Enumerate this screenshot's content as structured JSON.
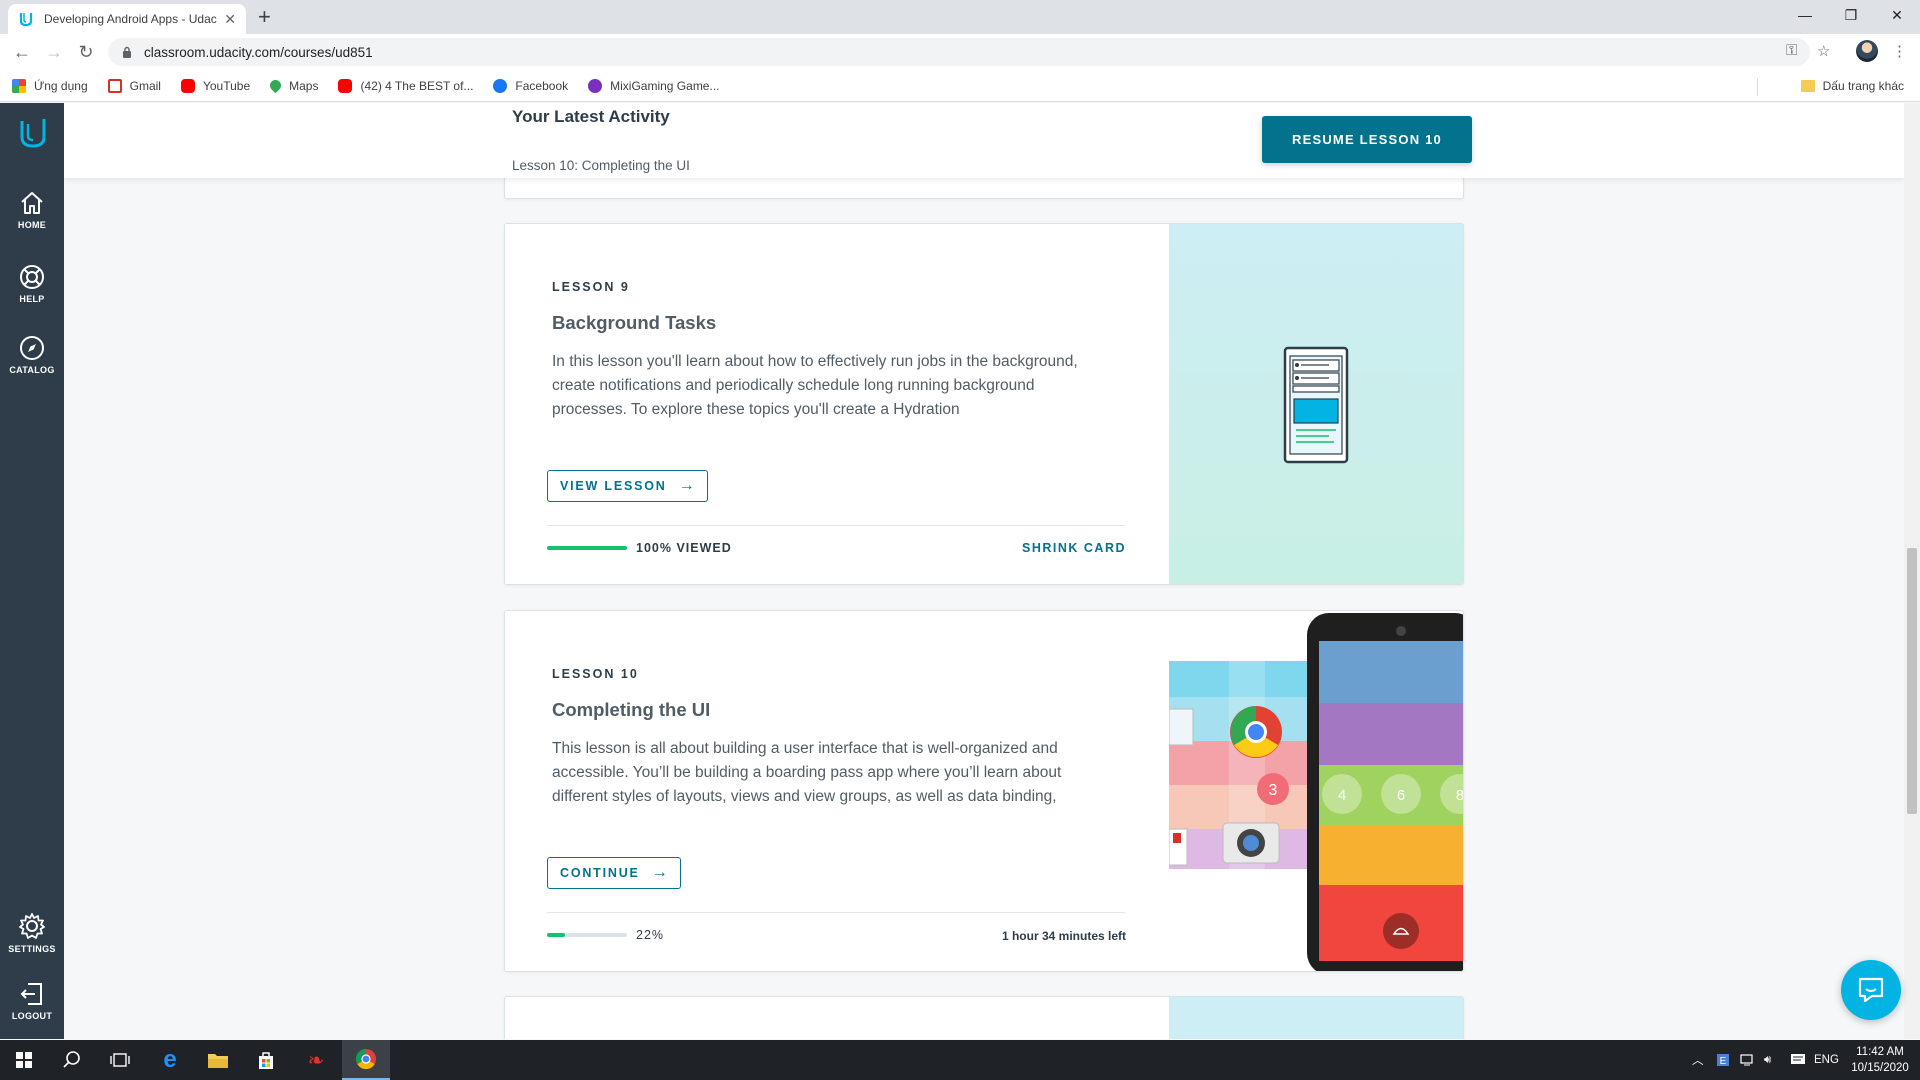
{
  "browser": {
    "tab_title": "Developing Android Apps - Udac",
    "url": "classroom.udacity.com/courses/ud851",
    "bookmarks": [
      {
        "label": "Ứng dụng",
        "color": "#e94235"
      },
      {
        "label": "Gmail",
        "color": "#d93025"
      },
      {
        "label": "YouTube",
        "color": "#ff0000"
      },
      {
        "label": "Maps",
        "color": "#34a853"
      },
      {
        "label": "(42) 4 The BEST of...",
        "color": "#ff0000"
      },
      {
        "label": "Facebook",
        "color": "#1877f2"
      },
      {
        "label": "MixiGaming Game...",
        "color": "#7b2fbe"
      }
    ],
    "other_bookmarks": "Dấu trang khác"
  },
  "sidebar": {
    "items": [
      {
        "label": "HOME",
        "icon": "home-icon"
      },
      {
        "label": "HELP",
        "icon": "lifebuoy-icon"
      },
      {
        "label": "CATALOG",
        "icon": "compass-icon"
      },
      {
        "label": "SETTINGS",
        "icon": "gear-icon"
      },
      {
        "label": "LOGOUT",
        "icon": "logout-icon"
      }
    ]
  },
  "activity": {
    "heading": "Your Latest Activity",
    "subtitle": "Lesson 10: Completing the UI",
    "resume_label": "RESUME LESSON 10"
  },
  "lessons": [
    {
      "number": "LESSON 9",
      "title": "Background Tasks",
      "description": "In this lesson you'll learn about how to effectively run jobs in the background, create notifications and periodically schedule long running background processes. To explore these topics you'll create a Hydration",
      "button_label": "VIEW LESSON",
      "progress": 1.0,
      "progress_label": "100% VIEWED",
      "right_label": "SHRINK CARD"
    },
    {
      "number": "LESSON 10",
      "title": "Completing the UI",
      "description": "This lesson is all about building a user interface that is well-organized and accessible. You’ll be building a boarding pass app where you’ll learn about different styles of layouts, views and view groups, as well as data binding,",
      "button_label": "CONTINUE",
      "progress": 0.22,
      "progress_label": "22%",
      "right_label": "1 hour 34 minutes left"
    }
  ],
  "art": {
    "phone_badges": [
      "3",
      "4",
      "6",
      "8"
    ]
  },
  "taskbar": {
    "language": "ENG",
    "time": "11:42 AM",
    "date": "10/15/2020"
  },
  "colors": {
    "accent": "#02728d",
    "sidebar": "#2e3d49",
    "progress_complete": "#15c26b",
    "progress_partial": "#15c26b"
  }
}
